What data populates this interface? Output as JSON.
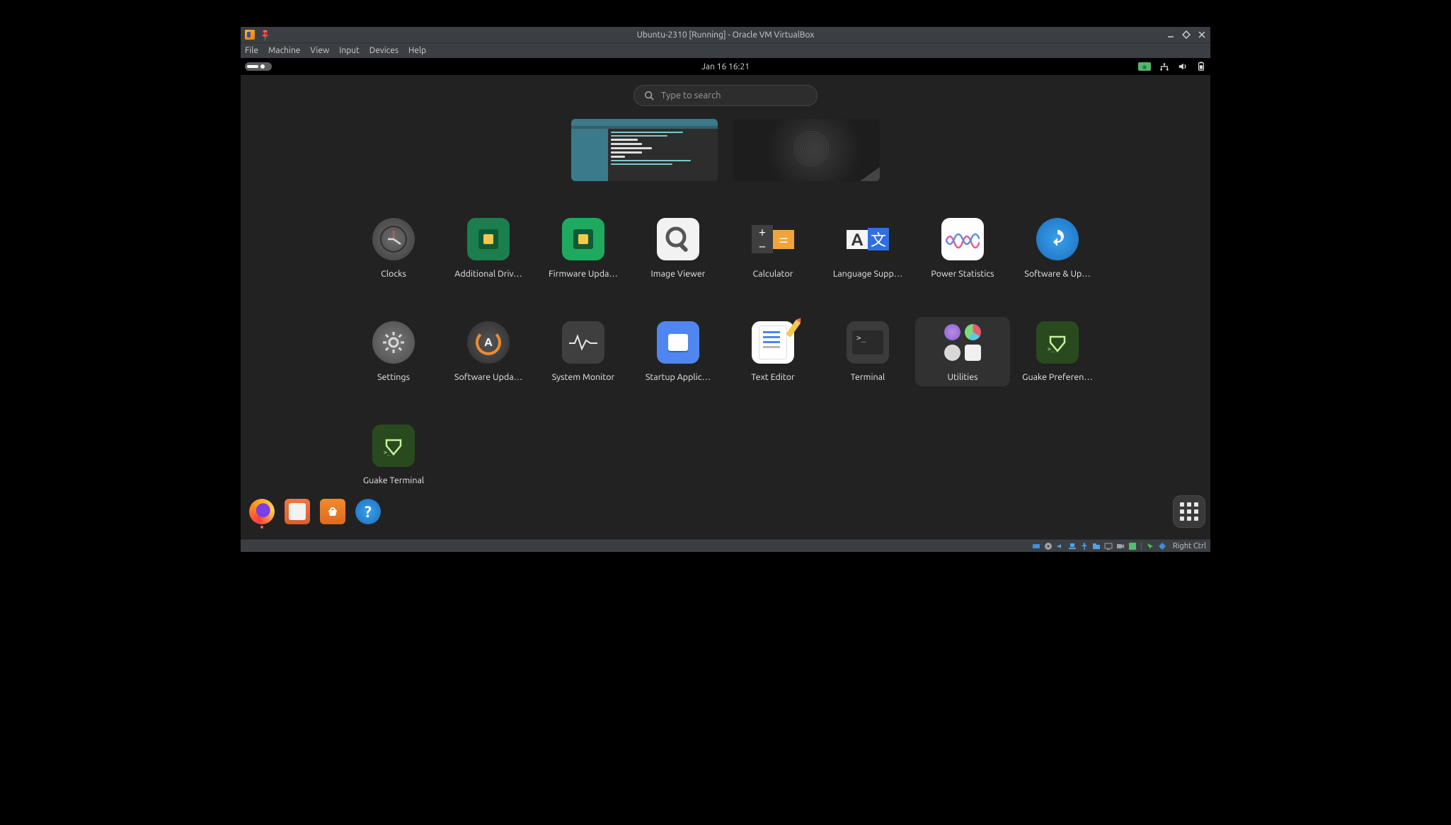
{
  "vb": {
    "title": "Ubuntu-2310 [Running] - Oracle VM VirtualBox",
    "menu": {
      "file": "File",
      "machine": "Machine",
      "view": "View",
      "input": "Input",
      "devices": "Devices",
      "help": "Help"
    },
    "host_key": "Right Ctrl"
  },
  "topbar": {
    "clock": "Jan 16   16:21"
  },
  "search": {
    "placeholder": "Type to search"
  },
  "apps": {
    "clocks": "Clocks",
    "add_drivers": "Additional Driv…",
    "firmware": "Firmware Upda…",
    "image_viewer": "Image Viewer",
    "calculator": "Calculator",
    "language": "Language Supp…",
    "power_stats": "Power Statistics",
    "software_updates": "Software & Up…",
    "settings": "Settings",
    "software_updater": "Software Upda…",
    "sysmon": "System Monitor",
    "startup": "Startup Applic…",
    "texteditor": "Text Editor",
    "terminal": "Terminal",
    "utilities": "Utilities",
    "guake_pref": "Guake Preferen…",
    "guake_term": "Guake Terminal"
  }
}
